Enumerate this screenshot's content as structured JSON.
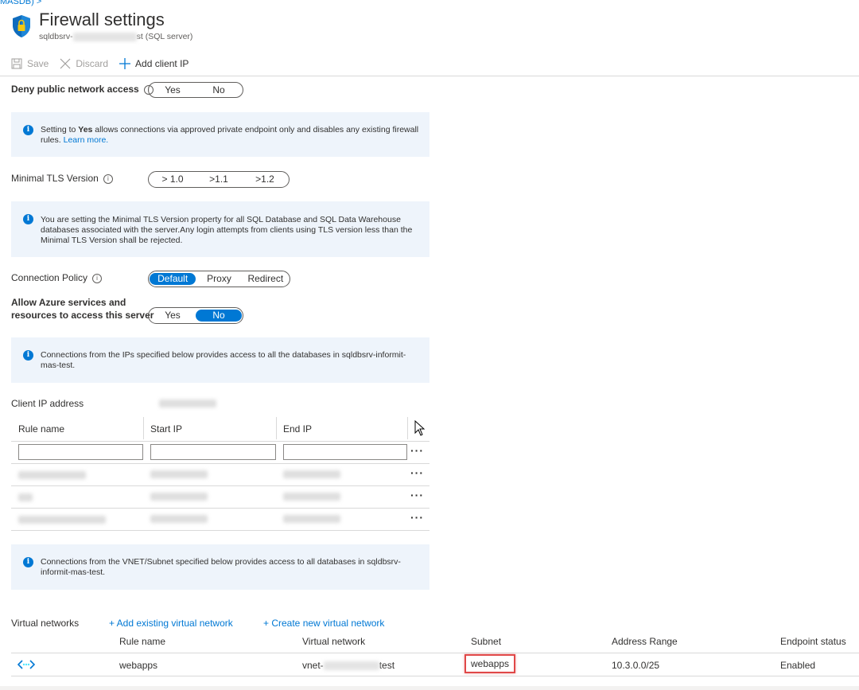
{
  "breadcrumb": "MASDB) >",
  "header": {
    "title": "Firewall settings",
    "subtitle_prefix": "sqldbsrv-",
    "subtitle_suffix": "st (SQL server)"
  },
  "toolbar": {
    "save": "Save",
    "discard": "Discard",
    "add_client_ip": "Add client IP"
  },
  "deny_public": {
    "label": "Deny public network access",
    "options": [
      "Yes",
      "No"
    ],
    "selected": ""
  },
  "info1": {
    "pre": "Setting to ",
    "bold": "Yes",
    "post": " allows connections via approved private endpoint only and disables any existing firewall rules.",
    "link": "Learn more."
  },
  "tls": {
    "label": "Minimal TLS Version",
    "options": [
      "> 1.0",
      ">1.1",
      ">1.2"
    ]
  },
  "info2": {
    "text": "You are setting the Minimal TLS Version property for all SQL Database and SQL Data Warehouse databases associated with the server.Any login attempts from clients using TLS version less than the Minimal TLS Version shall be rejected."
  },
  "connection_policy": {
    "label": "Connection Policy",
    "options": [
      "Default",
      "Proxy",
      "Redirect"
    ],
    "selected": "Default"
  },
  "allow_azure": {
    "label_line1": "Allow Azure services and",
    "label_line2": "resources to access this server",
    "options": [
      "Yes",
      "No"
    ],
    "selected": "No"
  },
  "info3": {
    "text": "Connections from the IPs specified below provides access to all the databases in sqldbsrv-informit-mas-test."
  },
  "client_ip": {
    "label": "Client IP address"
  },
  "firewall_table": {
    "headers": [
      "Rule name",
      "Start IP",
      "End IP"
    ],
    "more": "···"
  },
  "info4": {
    "text": "Connections from the VNET/Subnet specified below provides access to all databases in sqldbsrv-informit-mas-test."
  },
  "vnet": {
    "label": "Virtual networks",
    "add_existing": "+ Add existing virtual network",
    "create_new": "+ Create new virtual network",
    "headers": [
      "Rule name",
      "Virtual network",
      "Subnet",
      "Address Range",
      "Endpoint status"
    ],
    "row": {
      "rule_name": "webapps",
      "vnet_prefix": "vnet-",
      "vnet_suffix": "test",
      "subnet": "webapps",
      "address_range": "10.3.0.0/25",
      "status": "Enabled"
    }
  },
  "colors": {
    "accent": "#0078d4",
    "info_bg": "#eef4fb",
    "highlight": "#e04848"
  }
}
